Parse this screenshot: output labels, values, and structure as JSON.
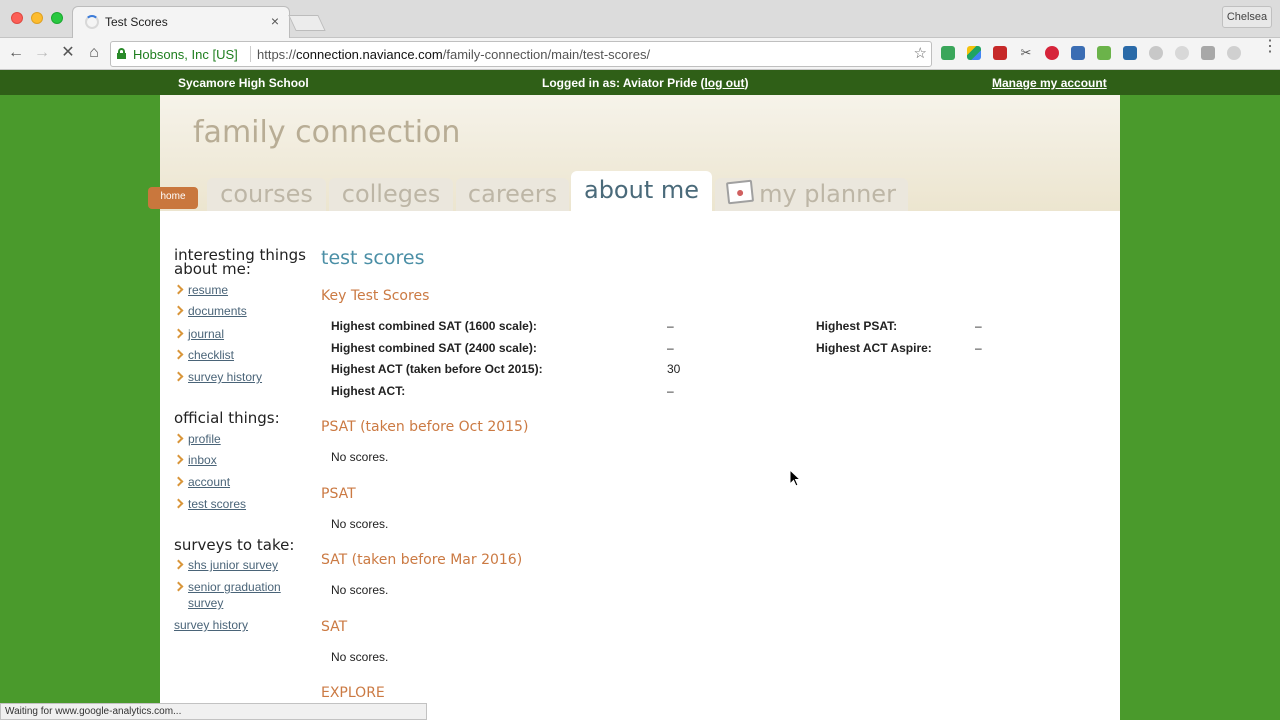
{
  "browser": {
    "tab_title": "Test Scores",
    "tab_close": "×",
    "profile": "Chelsea",
    "site_identity": "Hobsons, Inc [US]",
    "url_scheme": "https://",
    "url_host": "connection.naviance.com",
    "url_path": "/family-connection/main/test-scores/",
    "star_icon": "☆",
    "status_text": "Waiting for www.google-analytics.com..."
  },
  "sitebar": {
    "school": "Sycamore High School",
    "logged_prefix": "Logged in as: Aviator Pride (",
    "logout": "log out",
    "logged_suffix": ")",
    "manage": "Manage my account"
  },
  "header": {
    "title": "family connection",
    "home": "home",
    "tabs": {
      "courses": "courses",
      "colleges": "colleges",
      "careers": "careers",
      "about": "about me",
      "planner": "my planner"
    }
  },
  "sidebar": {
    "interesting_heading_1": "interesting things",
    "interesting_heading_2": "about me:",
    "interesting": [
      "resume",
      "documents",
      "journal",
      "checklist",
      "survey history"
    ],
    "official_heading": "official things:",
    "official": [
      "profile",
      "inbox",
      "account",
      "test scores"
    ],
    "surveys_heading": "surveys to take:",
    "survey_1": "shs junior survey",
    "survey_2a": "senior graduation",
    "survey_2b": "survey",
    "survey_history": "survey history"
  },
  "main": {
    "title": "test scores",
    "key_heading": "Key Test Scores",
    "key_scores": {
      "sat1600_label": "Highest combined SAT (1600 scale):",
      "sat1600_value": "–",
      "sat2400_label": "Highest combined SAT (2400 scale):",
      "sat2400_value": "–",
      "act_old_label": "Highest ACT (taken before Oct 2015):",
      "act_old_value": "30",
      "act_label": "Highest ACT:",
      "act_value": "–",
      "psat_label": "Highest PSAT:",
      "psat_value": "–",
      "aspire_label": "Highest ACT Aspire:",
      "aspire_value": "–"
    },
    "sections": [
      {
        "heading": "PSAT (taken before Oct 2015)",
        "text": "No scores."
      },
      {
        "heading": "PSAT",
        "text": "No scores."
      },
      {
        "heading": "SAT (taken before Mar 2016)",
        "text": "No scores."
      },
      {
        "heading": "SAT",
        "text": "No scores."
      },
      {
        "heading": "EXPLORE",
        "text": ""
      }
    ]
  },
  "colors": {
    "page_bg": "#4a9a2c",
    "sitebar": "#2f5f17",
    "section_heading": "#cb7a43",
    "title": "#4b8fa6",
    "link": "#4a6478"
  }
}
